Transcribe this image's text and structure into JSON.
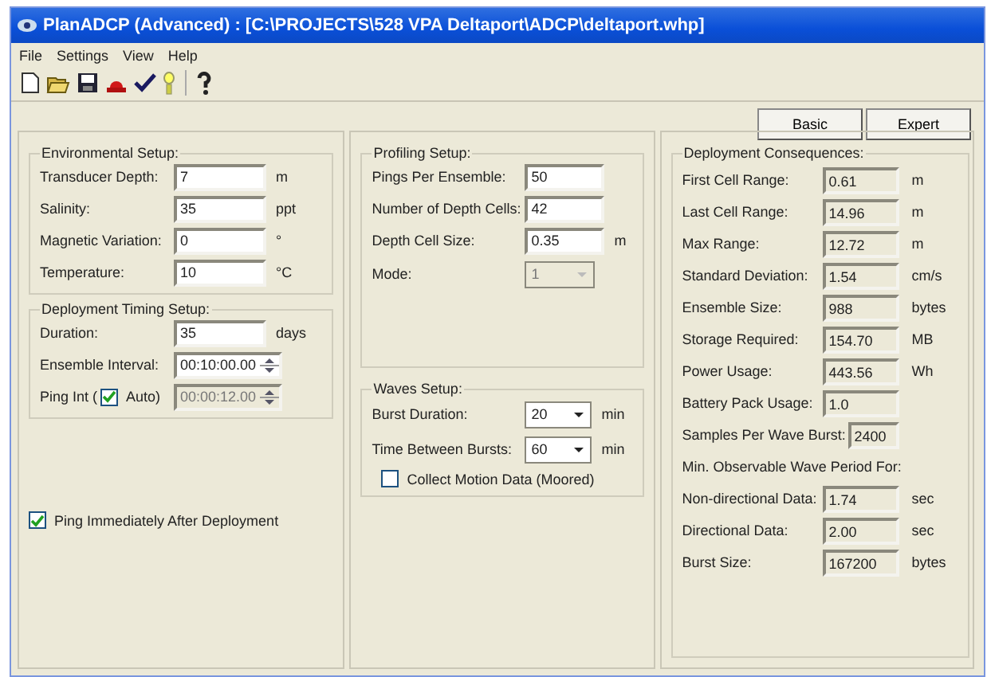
{
  "window": {
    "title": "PlanADCP (Advanced) : [C:\\PROJECTS\\528 VPA Deltaport\\ADCP\\deltaport.whp]"
  },
  "menu": [
    "File",
    "Settings",
    "View",
    "Help"
  ],
  "mode_buttons": [
    {
      "label": "Basic"
    },
    {
      "label": "Expert"
    }
  ],
  "environmental_setup": {
    "title": "Environmental Setup:",
    "fields": [
      {
        "kind": "input",
        "label": "Transducer Depth:",
        "value": "7",
        "unit": "m"
      },
      {
        "kind": "input",
        "label": "Salinity:",
        "value": "35",
        "unit": "ppt"
      },
      {
        "kind": "input",
        "label": "Magnetic Variation:",
        "value": "0",
        "unit": "°"
      },
      {
        "kind": "input",
        "label": "Temperature:",
        "value": "10",
        "unit": "°C"
      }
    ]
  },
  "deployment_timing_setup": {
    "title": "Deployment Timing Setup:",
    "fields": [
      {
        "kind": "input",
        "label": "Duration:",
        "value": "35",
        "unit": "days",
        "disabled": false
      },
      {
        "kind": "spinner",
        "label": "Ensemble Interval:",
        "value": "00:10:00.00",
        "disabled": false
      },
      {
        "kind": "auto_spinner",
        "label": "Ping Int (",
        "check_label": "Auto)",
        "checked": true,
        "value": "00:00:12.00",
        "disabled": true
      }
    ]
  },
  "ping_immediately": {
    "label": "Ping Immediately After Deployment",
    "checked": true
  },
  "profiling_setup": {
    "title": "Profiling Setup:",
    "fields": [
      {
        "kind": "input",
        "label": "Pings Per Ensemble:",
        "value": "50",
        "disabled": false
      },
      {
        "kind": "input",
        "label": "Number of Depth Cells:",
        "value": "42",
        "disabled": false
      },
      {
        "kind": "input",
        "label": "Depth Cell Size:",
        "value": "0.35",
        "unit": "m",
        "disabled": false
      },
      {
        "kind": "dropdown",
        "label": "Mode:",
        "value": "1",
        "disabled": true
      }
    ]
  },
  "waves_setup": {
    "title": "Waves Setup:",
    "fields": [
      {
        "kind": "dropdown",
        "label": "Burst Duration:",
        "value": "20",
        "unit": "min",
        "disabled": false
      },
      {
        "kind": "dropdown",
        "label": "Time Between Bursts:",
        "value": "60",
        "unit": "min",
        "disabled": false
      }
    ],
    "collect_motion": {
      "label": "Collect Motion Data (Moored)",
      "checked": false
    }
  },
  "deployment_consequences": {
    "title": "Deployment Consequences:",
    "rows": [
      {
        "kind": "value",
        "label": "First Cell Range:",
        "value": "0.61",
        "unit": "m"
      },
      {
        "kind": "value",
        "label": "Last Cell Range:",
        "value": "14.96",
        "unit": "m"
      },
      {
        "kind": "value",
        "label": "Max Range:",
        "value": "12.72",
        "unit": "m"
      },
      {
        "kind": "value",
        "label": "Standard Deviation:",
        "value": "1.54",
        "unit": "cm/s"
      },
      {
        "kind": "value",
        "label": "Ensemble Size:",
        "value": "988",
        "unit": "bytes"
      },
      {
        "kind": "value",
        "label": "Storage Required:",
        "value": "154.70",
        "unit": "MB"
      },
      {
        "kind": "value",
        "label": "Power Usage:",
        "value": "443.56",
        "unit": "Wh"
      },
      {
        "kind": "value",
        "label": "Battery Pack Usage:",
        "value": "1.0"
      },
      {
        "kind": "wide",
        "label": "Samples Per Wave Burst:",
        "value": "2400"
      },
      {
        "kind": "note",
        "label": "Min. Observable Wave Period For:"
      },
      {
        "kind": "value",
        "label": "Non-directional Data:",
        "value": "1.74",
        "unit": "sec"
      },
      {
        "kind": "value",
        "label": "Directional Data:",
        "value": "2.00",
        "unit": "sec"
      },
      {
        "kind": "value",
        "label": "Burst Size:",
        "value": "167200",
        "unit": "bytes"
      }
    ]
  }
}
